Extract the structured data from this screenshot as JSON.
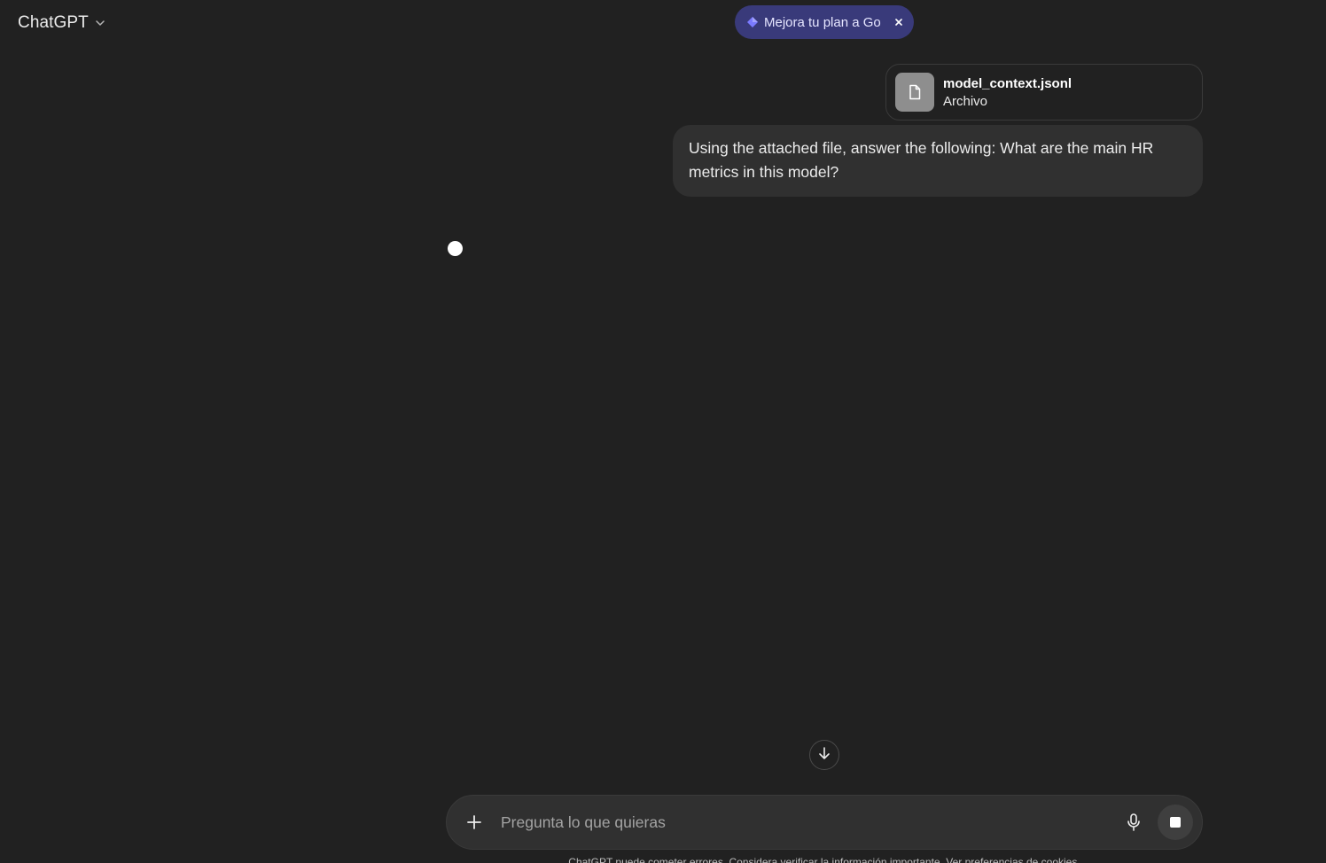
{
  "header": {
    "model_name": "ChatGPT",
    "icons": {
      "chevron": "chevron-down-icon"
    }
  },
  "upgrade_banner": {
    "label": "Mejora tu plan a Go",
    "accent_color": "#393a7a",
    "icons": {
      "diamond": "diamond-icon",
      "close": "close-icon"
    }
  },
  "conversation": {
    "attachment": {
      "file_name": "model_context.jsonl",
      "file_type": "Archivo",
      "icon": "document-icon"
    },
    "user_message": "Using the attached file, answer the following: What are the main HR metrics in this model?",
    "assistant_state": "thinking"
  },
  "composer": {
    "placeholder": "Pregunta lo que quieras",
    "value": "",
    "icons": {
      "add": "plus-icon",
      "mic": "microphone-icon",
      "stop": "stop-icon"
    }
  },
  "scroll_button": {
    "icon": "arrow-down-icon"
  },
  "footer": {
    "disclaimer": "ChatGPT puede cometer errores. Considera verificar la información importante. Ver preferencias de cookies."
  }
}
